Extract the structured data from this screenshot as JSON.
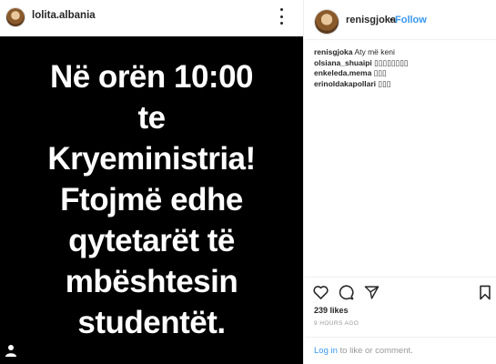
{
  "left": {
    "username": "lolita.albania",
    "post_lines": [
      "Në orën 10:00",
      "te",
      "Kryeministria!",
      "Ftojmë edhe",
      "qytetarët të",
      "mbështesin",
      "studentët."
    ]
  },
  "right": {
    "username": "renisgjoka",
    "separator": "•",
    "follow_label": "Follow",
    "comments": [
      {
        "user": "renisgjoka",
        "text": "Aty më keni"
      },
      {
        "user": "olsiana_shuaipi",
        "text": "▯▯▯▯▯▯▯▯"
      },
      {
        "user": "enkeleda.mema",
        "text": "▯▯▯"
      },
      {
        "user": "erinoldakapollari",
        "text": "▯▯▯"
      }
    ],
    "likes": "239 likes",
    "time": "9 HOURS AGO",
    "login_link": "Log in",
    "login_rest": " to like or comment."
  },
  "colors": {
    "accent": "#3897f0",
    "image_bg": "#000000",
    "text": "#262626",
    "muted": "#999999"
  },
  "icons": [
    "more-dots-icon",
    "heart-icon",
    "comment-icon",
    "share-icon",
    "bookmark-icon",
    "tag-person-icon"
  ]
}
